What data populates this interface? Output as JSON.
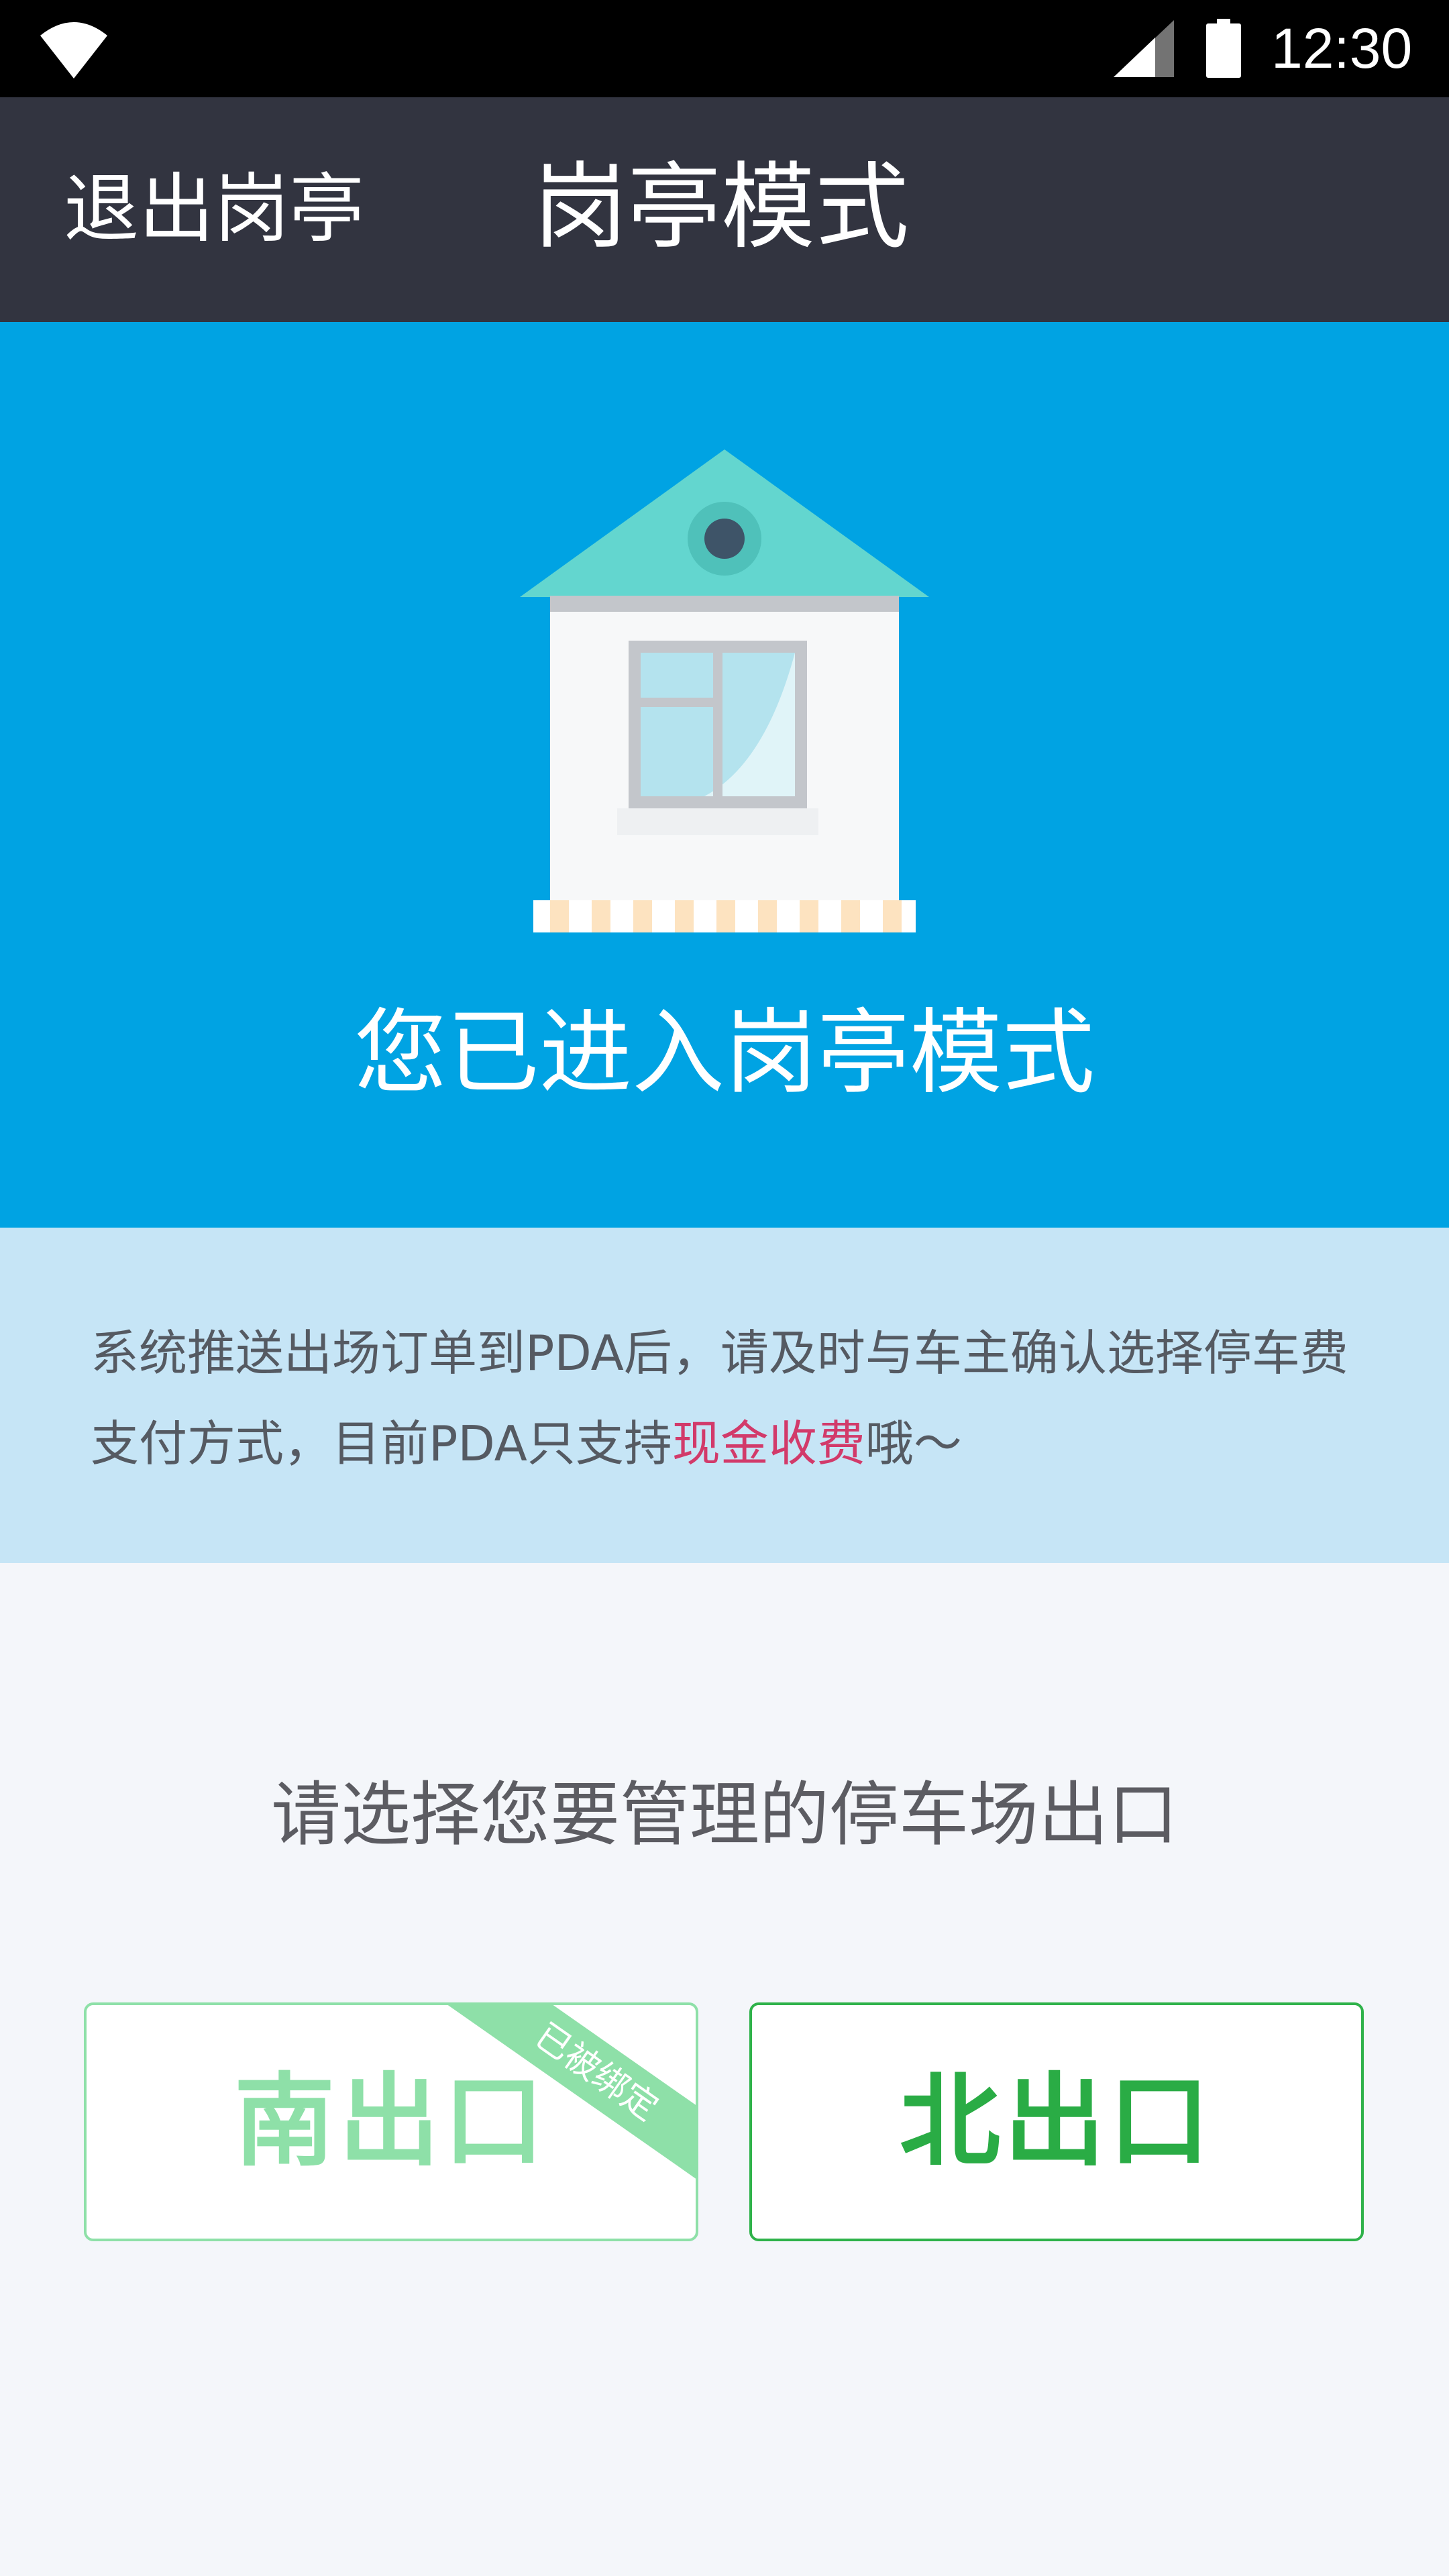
{
  "status_bar": {
    "time": "12:30",
    "icons": [
      "wifi-icon",
      "signal-icon",
      "battery-icon"
    ]
  },
  "header": {
    "exit_label": "退出岗亭",
    "title": "岗亭模式"
  },
  "hero": {
    "illustration": "booth-icon",
    "title": "您已进入岗亭模式"
  },
  "notice": {
    "text_before": "系统推送出场订单到PDA后，请及时与车主确认选择停车费支付方式，目前PDA只支持",
    "highlight": "现金收费",
    "text_after": "哦～",
    "highlight_color": "#d23a6a"
  },
  "selection": {
    "prompt": "请选择您要管理的停车场出口",
    "exits": [
      {
        "label": "南出口",
        "badge": "已被绑定",
        "bound": true
      },
      {
        "label": "北出口",
        "badge": "",
        "bound": false
      }
    ]
  },
  "colors": {
    "status_bar": "#000000",
    "header": "#323440",
    "hero": "#00a3e3",
    "notice": "#c6e5f6",
    "page": "#f4f6fa",
    "bound_green": "#8ee0a8",
    "active_green": "#2aac45"
  }
}
